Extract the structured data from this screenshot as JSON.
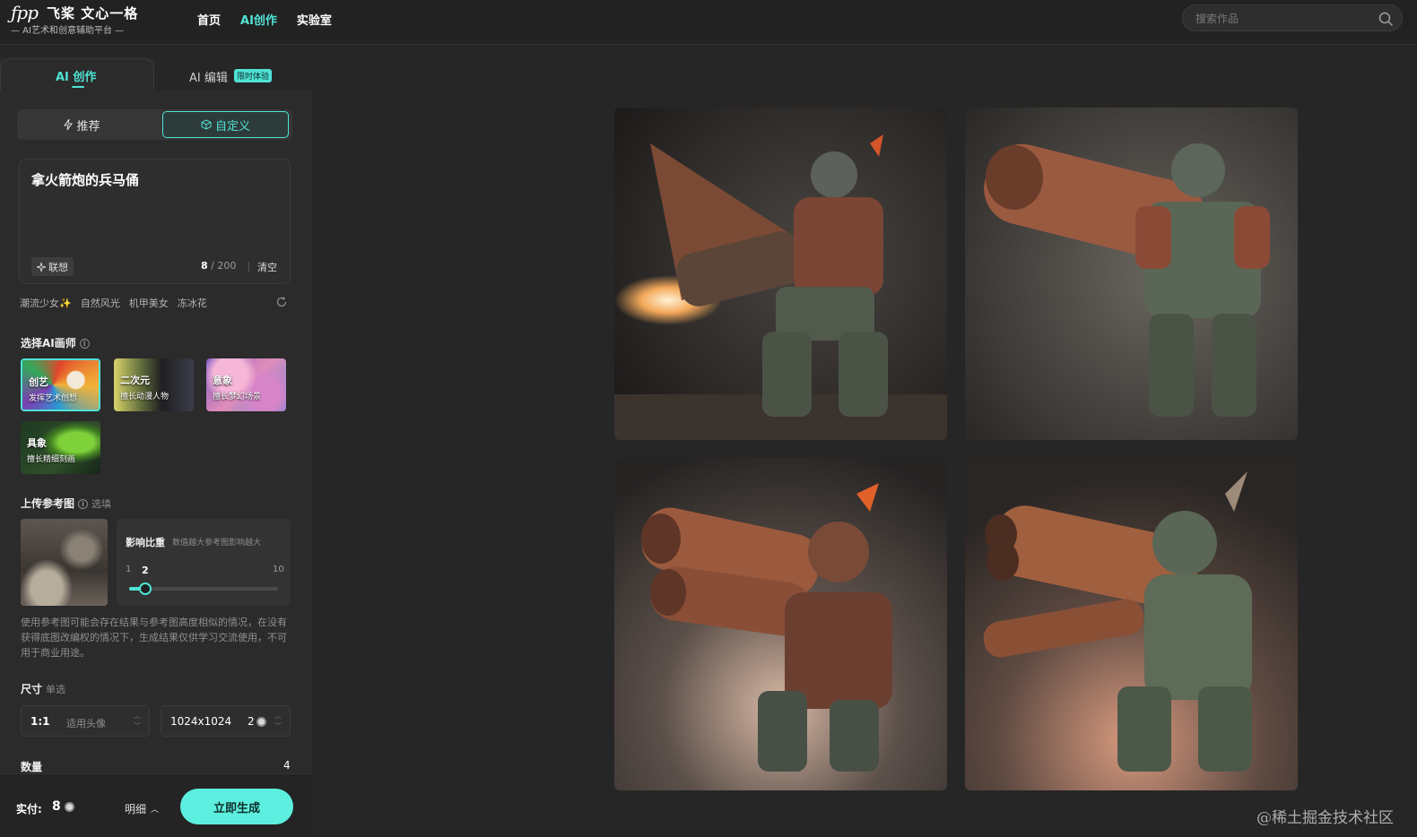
{
  "header": {
    "logo_mark": "ꩰ꧁",
    "brand_name": "飞桨 文心一格",
    "brand_tagline": "— AI艺术和创意辅助平台 —",
    "nav": [
      {
        "label": "首页",
        "active": false
      },
      {
        "label": "AI创作",
        "active": true
      },
      {
        "label": "实验室",
        "active": false
      }
    ],
    "search": {
      "placeholder": "搜索作品",
      "icon": "search-icon"
    }
  },
  "panel": {
    "tabs": {
      "create": "AI 创作",
      "edit": "AI 编辑",
      "edit_badge": "限时体验"
    },
    "modes": {
      "recommend": "推荐",
      "custom": "自定义",
      "selected": "custom"
    },
    "prompt": {
      "text": "拿火箭炮的兵马俑",
      "assoc_label": "联想",
      "count": "8",
      "max": "/ 200",
      "clear_label": "清空"
    },
    "tags": [
      "潮流少女✨",
      "自然风光",
      "机甲美女",
      "冻冰花"
    ],
    "artist_section": {
      "title": "选择AI画师"
    },
    "artists": [
      {
        "name": "创艺",
        "desc": "发挥艺术创想",
        "selected": true
      },
      {
        "name": "二次元",
        "desc": "擅长动漫人物",
        "selected": false
      },
      {
        "name": "意象",
        "desc": "擅长梦幻场景",
        "selected": false
      },
      {
        "name": "具象",
        "desc": "擅长精细刻画",
        "selected": false
      }
    ],
    "upload_section": {
      "title": "上传参考图",
      "optional": "选填"
    },
    "weight": {
      "title": "影响比重",
      "hint": "数值越大参考图影响越大",
      "min": "1",
      "current": "2",
      "max": "10",
      "value": 2,
      "range": [
        1,
        10
      ]
    },
    "disclaimer": "使用参考图可能会存在结果与参考图高度相似的情况，在没有获得底图改编权的情况下，生成结果仅供学习交流使用，不可用于商业用途。",
    "size_section": {
      "title": "尺寸",
      "mode": "单选"
    },
    "size": {
      "ratio": "1:1",
      "ratio_note": "适用头像",
      "resolution": "1024x1024",
      "cost": "2"
    },
    "quantity": {
      "label": "数量",
      "value": "4"
    },
    "footer": {
      "pay_label": "实付:",
      "pay_value": "8",
      "detail_label": "明细",
      "generate_label": "立即生成"
    }
  },
  "results": {
    "count": 4,
    "items": [
      "terracotta-warrior-rocket-1",
      "terracotta-warrior-rocket-2",
      "terracotta-warrior-rocket-3",
      "terracotta-warrior-rocket-4"
    ]
  },
  "watermark": "@稀土掘金技术社区",
  "colors": {
    "accent": "#4fe3d6",
    "background": "#262626",
    "panel": "#2b2b2b",
    "generate_button": "#5cefdf"
  }
}
